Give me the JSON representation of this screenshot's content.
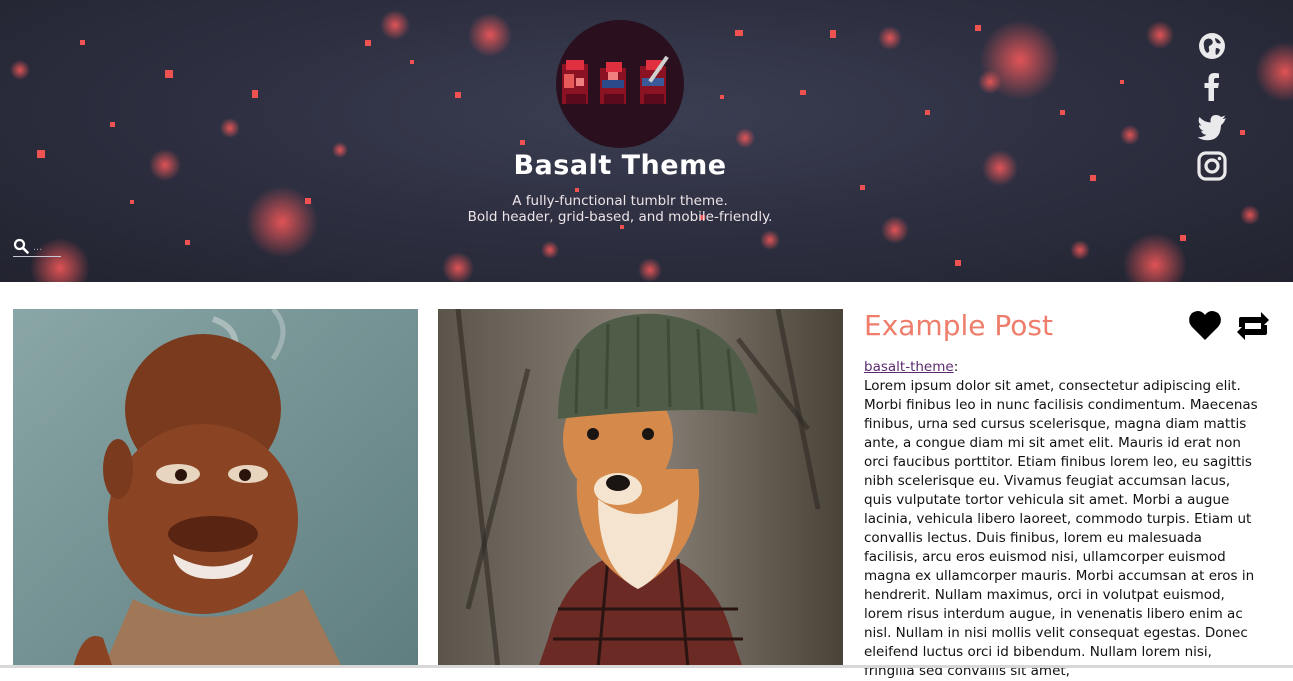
{
  "header": {
    "title": "Basalt Theme",
    "description_line1": "A fully-functional tumblr theme.",
    "description_line2": "Bold header, grid-based, and mobile-friendly.",
    "search_placeholder": "...",
    "search_icon": "search-icon",
    "social_icons": [
      "globe-icon",
      "facebook-icon",
      "twitter-icon",
      "instagram-icon"
    ],
    "accent_color": "#e5484d"
  },
  "posts": {
    "image_post_1_label": "caricature illustration",
    "image_post_2_label": "dog in beanie photo",
    "text_post": {
      "title": "Example Post",
      "source_link": "basalt-theme",
      "source_suffix": ":",
      "body": "Lorem ipsum dolor sit amet, consectetur adipiscing elit. Morbi finibus leo in nunc facilisis condimentum. Maecenas finibus, urna sed cursus scelerisque, magna diam mattis ante, a congue diam mi sit amet elit. Mauris id erat non orci faucibus porttitor. Etiam finibus lorem leo, eu sagittis nibh scelerisque eu. Vivamus feugiat accumsan lacus, quis vulputate tortor vehicula sit amet. Morbi a augue lacinia, vehicula libero laoreet, commodo turpis. Etiam ut convallis lectus. Duis finibus, lorem eu malesuada facilisis, arcu eros euismod nisi, ullamcorper euismod magna ex ullamcorper mauris. Morbi accumsan at eros in hendrerit. Nullam maximus, orci in volutpat euismod, lorem risus interdum augue, in venenatis libero enim ac nisl. Nullam in nisi mollis velit consequat egestas. Donec eleifend luctus orci id bibendum. Nullam lorem nisi, fringilla sed convallis sit amet,",
      "title_color": "#ef7d6b",
      "like_icon": "heart-icon",
      "reblog_icon": "reblog-icon"
    }
  }
}
